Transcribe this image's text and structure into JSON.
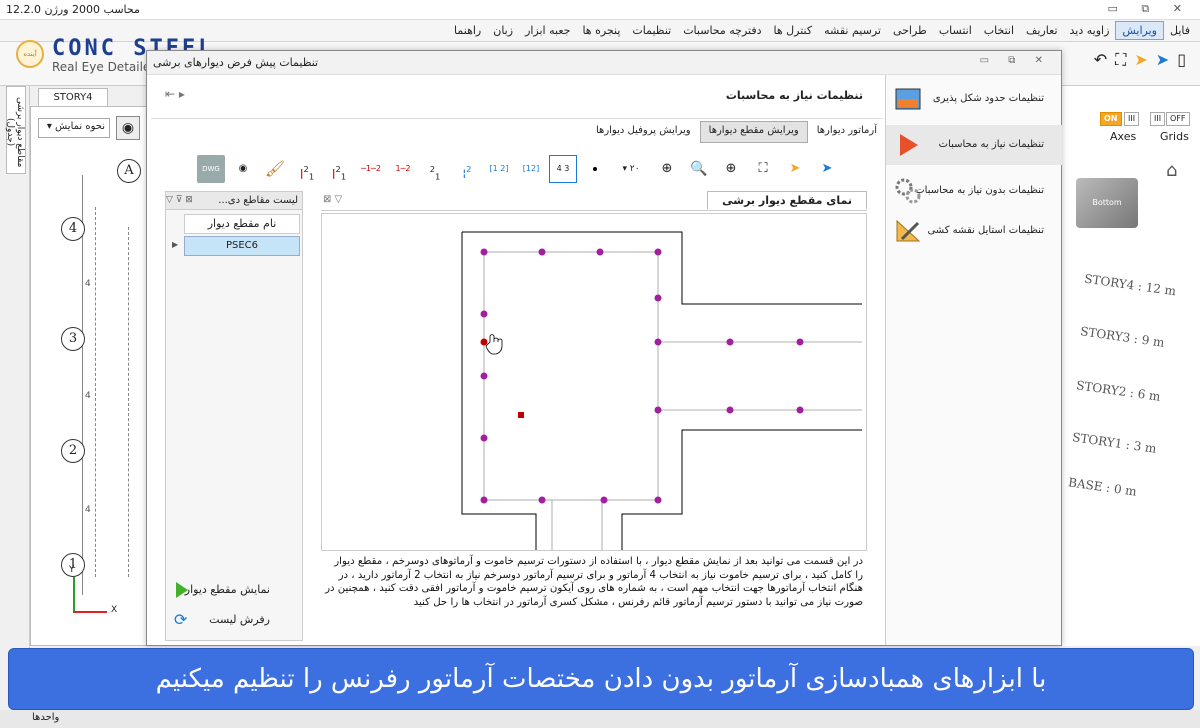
{
  "app": {
    "title": "محاسب 2000 ورژن 12.2.0",
    "window_buttons": "▭ ⧉ ✕"
  },
  "menu": {
    "items": [
      "فایل",
      "ویرایش",
      "زاویه دید",
      "تعاریف",
      "انتخاب",
      "انتساب",
      "طراحی",
      "ترسیم نقشه",
      "کنترل ها",
      "دفترچه محاسبات",
      "تنظیمات",
      "پنجره ها",
      "جعبه ابزار",
      "زبان",
      "راهنما"
    ],
    "active_index": 1
  },
  "logo": {
    "badge": "آینده",
    "brand": "CONC STEEL",
    "subtitle": "Real Eye Detaile"
  },
  "left_strip": {
    "tab_label": "مقاطع دیوار برشی (جدول)"
  },
  "story_tab": "STORY4",
  "view_select": "نحوه نمایش",
  "grid_labels": [
    "A",
    "4",
    "3",
    "2",
    "1"
  ],
  "dim_labels": [
    "4",
    "4",
    "4",
    "4"
  ],
  "right_panel": {
    "axes_label": "Axes",
    "grids_label": "Grids",
    "on": "ON",
    "off": "OFF",
    "stories": [
      "STORY4 : 12 m",
      "STORY3 : 9 m",
      "STORY2 : 6 m",
      "STORY1 : 3 m",
      "BASE : 0 m"
    ],
    "cube_label": "Bottom"
  },
  "dialog": {
    "title": "تنظیمات پیش فرض دیوارهای برشی",
    "heading": "تنظیمات نیاز به محاسبات",
    "settings_menu": [
      {
        "label": "تنظیمات حدود شکل پذیری",
        "icon": "image-icon"
      },
      {
        "label": "تنظیمات نیاز به محاسبات",
        "icon": "play-icon"
      },
      {
        "label": "تنظیمات بدون نیاز به محاسبات",
        "icon": "gears-icon"
      },
      {
        "label": "تنظیمات استایل نقشه کشی",
        "icon": "drafting-icon"
      }
    ],
    "selected_setting": 1,
    "subtabs": [
      "آرماتور دیوارها",
      "ویرایش مقطع دیوارها",
      "ویرایش پروفیل دیوارها"
    ],
    "selected_subtab": 1,
    "toolbar": {
      "dwg": "DWG",
      "select_value": "۲۰"
    },
    "list_panel": {
      "header": "لیست مقاطع دی...",
      "column": "نام مقطع دیوار",
      "rows": [
        "PSEC6"
      ],
      "show_button": "نمایش مقطع دیوار",
      "refresh_button": "رفرش لیست"
    },
    "section_view": {
      "tab": "نمای مقطع دیوار برشی"
    },
    "description": "در این قسمت می توانید بعد از نمایش مقطع دیوار ، با استفاده از دستورات ترسیم خاموت و آرماتوهای دوسرخم ، مقطع دیوار را کامل کنید ، برای ترسیم خاموت نیاز به انتخاب 4 آرماتور و برای ترسیم آرماتور دوسرخم نیاز به انتخاب 2 آرماتور دارید ، در هنگام انتخاب آرماتورها جهت انتخاب مهم است ، به شماره های روی آیکون ترسیم خاموت و آرماتور افقی دقت کنید ، همچنین در صورت نیاز می توانید با دستور ترسیم آرماتور قائم رفرنس ، مشکل کسری آرماتور در انتخاب ها را حل کنید"
  },
  "banner": "با ابزارهای همبادسازی آرماتور بدون دادن مختصات آرماتور رفرنس را تنظیم میکنیم",
  "statusbar": "واحدها",
  "colors": {
    "rebar": "#a020a0",
    "selected_rebar": "#c00000",
    "banner": "#3c6fe0",
    "accent_orange": "#f5a623"
  }
}
